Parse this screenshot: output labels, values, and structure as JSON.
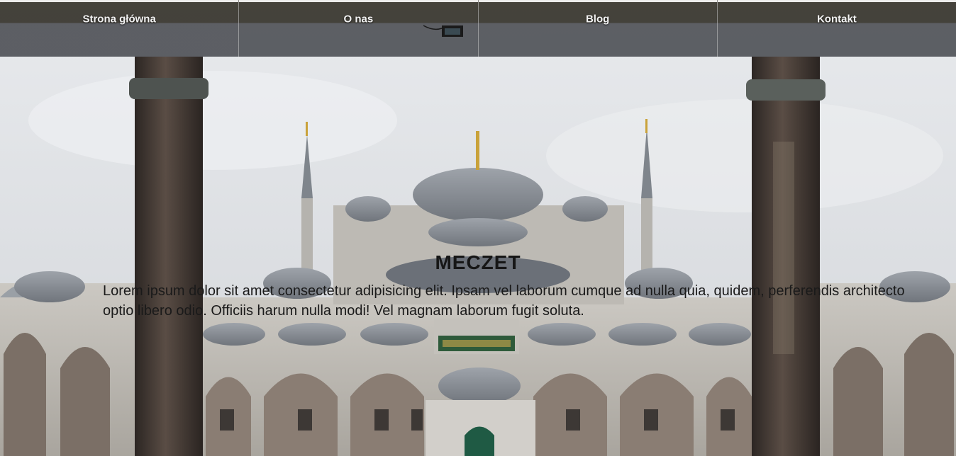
{
  "nav": {
    "items": [
      {
        "label": "Strona główna"
      },
      {
        "label": "O nas"
      },
      {
        "label": "Blog"
      },
      {
        "label": "Kontakt"
      }
    ]
  },
  "hero": {
    "title": "MECZET",
    "text": "Lorem ipsum dolor sit amet consectetur adipisicing elit. Ipsam vel laborum cumque ad nulla quia, quidem, perferendis architecto optio libero odio. Officiis harum nulla modi! Vel magnam laborum fugit soluta."
  },
  "background": {
    "image": "mosque-courtyard-photo",
    "sky_color": "#dfe2e6",
    "stone_color": "#b9b7b2",
    "column_color": "#3f3632"
  },
  "icons": {
    "security_camera": "camera-icon"
  }
}
